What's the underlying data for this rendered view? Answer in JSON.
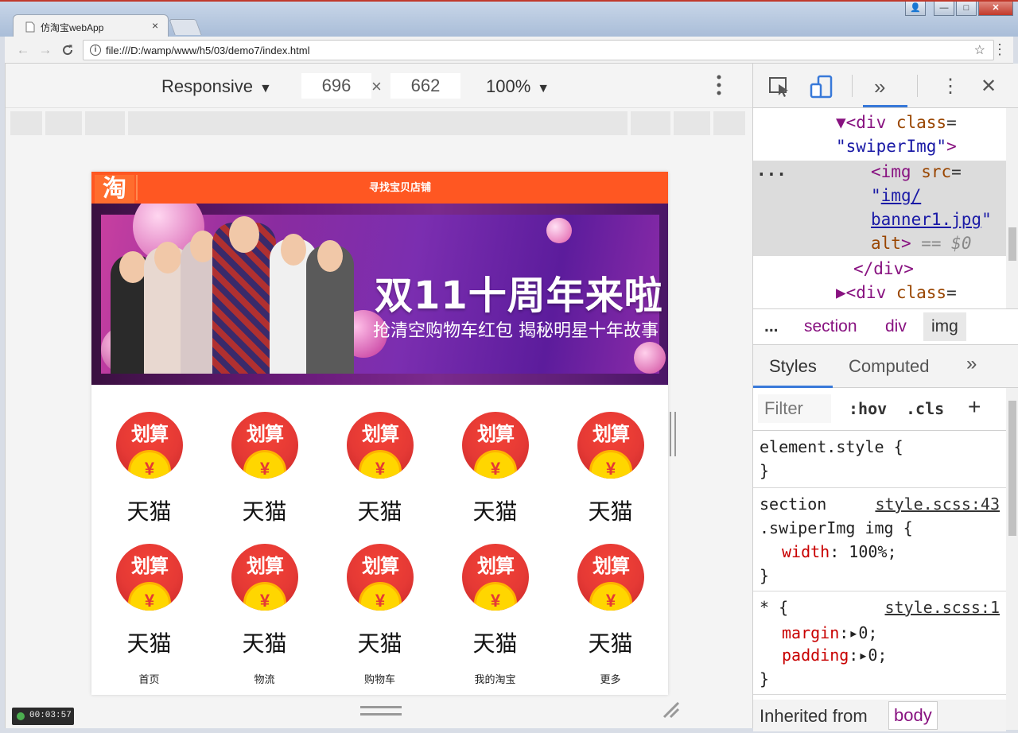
{
  "browser": {
    "tab_title": "仿淘宝webApp",
    "tab_close": "×",
    "url": "file:///D:/wamp/www/h5/03/demo7/index.html",
    "nav": {
      "back": "←",
      "forward": "→",
      "reload": "C"
    },
    "star_icon": "☆",
    "menu_icon": "⋮",
    "window_buttons": {
      "user": "👤",
      "minimize": "—",
      "maximize": "□",
      "close": "✕"
    }
  },
  "device_toolbar": {
    "device": "Responsive",
    "width": "696",
    "times": "×",
    "height": "662",
    "zoom": "100%",
    "caret": "▼",
    "more": "⋮"
  },
  "page": {
    "logo": "淘",
    "search_placeholder": "寻找宝贝店铺",
    "banner": {
      "title": "双11十周年来啦！",
      "subtitle": "抢清空购物车红包 揭秘明星十年故事"
    },
    "grid": {
      "coin_text": "划算",
      "yen": "¥",
      "items": [
        {
          "label": "天猫"
        },
        {
          "label": "天猫"
        },
        {
          "label": "天猫"
        },
        {
          "label": "天猫"
        },
        {
          "label": "天猫"
        },
        {
          "label": "天猫"
        },
        {
          "label": "天猫"
        },
        {
          "label": "天猫"
        },
        {
          "label": "天猫"
        },
        {
          "label": "天猫"
        }
      ]
    },
    "bottom_nav": [
      "首页",
      "物流",
      "购物车",
      "我的淘宝",
      "更多"
    ]
  },
  "devtools": {
    "toolbar": {
      "more_tabs": "»",
      "menu": "⋮",
      "close": "✕"
    },
    "elements": {
      "line1_tag_open": "▼<div ",
      "line1_attr": "class",
      "line1_eq": "=",
      "line2_val": "\"swiperImg\"",
      "line2_close": ">",
      "ellipsis": "...",
      "line3_tag": "<img ",
      "line3_attr": "src",
      "line3_eq": "=",
      "line4_quote": "\"",
      "line4_link": "img/",
      "line5_link": "banner1.jpg",
      "line5_quote": "\"",
      "line6_attr": "alt",
      "line6_close": ">",
      "line6_eq": " == ",
      "line6_ref": "$0",
      "line7": "</div>",
      "line8_tag_open": "▶<div ",
      "line8_attr": "class",
      "line8_eq": "="
    },
    "breadcrumbs": [
      "...",
      "section",
      "div",
      "img"
    ],
    "sidebar_tabs": {
      "styles": "Styles",
      "computed": "Computed",
      "more": "»"
    },
    "filter": {
      "placeholder": "Filter",
      "hov": ":hov",
      "cls": ".cls",
      "add": "+"
    },
    "styles": {
      "element_style_open": "element.style {",
      "element_style_close": "}",
      "rule1_selector_1": "section",
      "rule1_selector_2": ".swiperImg img {",
      "rule1_source": "style.scss:43",
      "rule1_prop": "width",
      "rule1_value": ": 100%;",
      "rule1_close": "}",
      "rule2_selector": "* {",
      "rule2_source": "style.scss:1",
      "rule2_prop1": "margin",
      "rule2_value1": ":▸0;",
      "rule2_prop2": "padding",
      "rule2_value2": ":▸0;",
      "rule2_close": "}"
    },
    "inherited_label": "Inherited from",
    "inherited_tag": "body"
  },
  "recorder_time": "00:03:57",
  "colors": {
    "header": "#ff5722",
    "accent_blue": "#3879d9",
    "coin_red": "#e53935",
    "coin_gold": "#ffd600"
  },
  "icons": [
    "info-icon",
    "star-icon",
    "inspect-icon",
    "device-toggle-icon",
    "close-icon",
    "resize-corner-icon",
    "chevron-right-icon"
  ]
}
